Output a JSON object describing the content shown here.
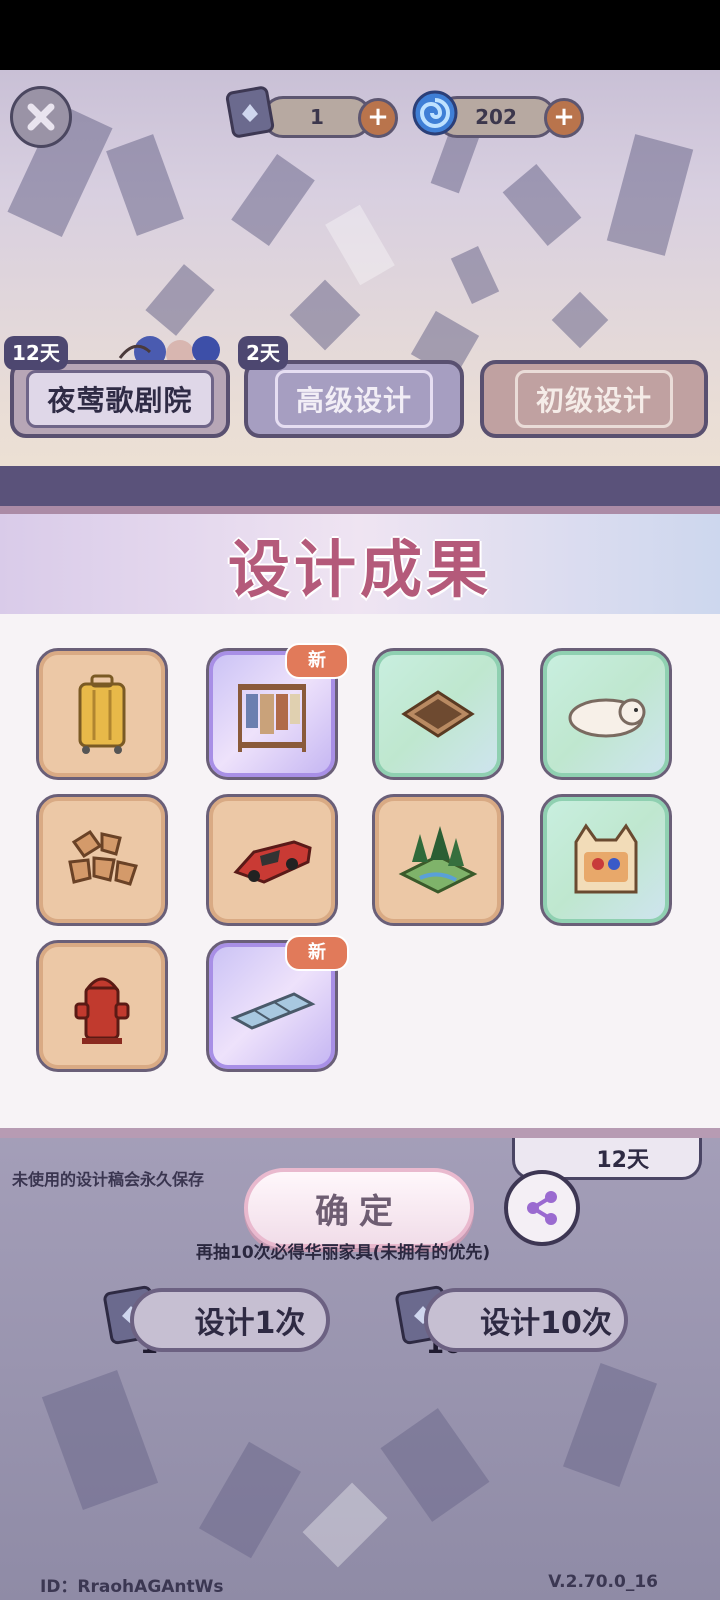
{
  "header": {
    "scroll_count": "1",
    "swirl_count": "202",
    "plus_label": "+"
  },
  "pools": [
    {
      "label": "夜莺歌剧院",
      "days": "12天"
    },
    {
      "label": "高级设计",
      "days": "2天"
    },
    {
      "label": "初级设计",
      "days": ""
    }
  ],
  "modal": {
    "title": "设计成果",
    "items": [
      {
        "icon": "suitcase-icon",
        "rarity": "basic",
        "badge": ""
      },
      {
        "icon": "clothes-rack-icon",
        "rarity": "epic",
        "badge": "新"
      },
      {
        "icon": "floor-hatch-icon",
        "rarity": "rare",
        "badge": ""
      },
      {
        "icon": "polar-bear-rug-icon",
        "rarity": "rare",
        "badge": ""
      },
      {
        "icon": "stone-path-icon",
        "rarity": "basic",
        "badge": ""
      },
      {
        "icon": "red-car-icon",
        "rarity": "basic",
        "badge": ""
      },
      {
        "icon": "forest-tile-icon",
        "rarity": "basic",
        "badge": ""
      },
      {
        "icon": "cat-cabinet-icon",
        "rarity": "rare",
        "badge": ""
      },
      {
        "icon": "fire-hydrant-icon",
        "rarity": "basic",
        "badge": ""
      },
      {
        "icon": "glass-floor-icon",
        "rarity": "epic",
        "badge": "新"
      }
    ],
    "confirm_label": "确定"
  },
  "bottom": {
    "note": "未使用的设计稿会永久保存",
    "days_left": "12天",
    "guarantee": "再抽10次必得华丽家具(未拥有的优先)",
    "draw_once_label": "设计1次",
    "draw_once_cost": "1",
    "draw_ten_label": "设计10次",
    "draw_ten_cost": "10"
  },
  "footer": {
    "id_text": "ID：RraohAGAntWs",
    "version": "V.2.70.0_16"
  },
  "colors": {
    "title": "#b45a7a",
    "new_badge": "#e17a5a",
    "basic_card": "#ecc8a6",
    "rare_card": "#bfe7cf",
    "epic_card": "#c9c1f5"
  }
}
